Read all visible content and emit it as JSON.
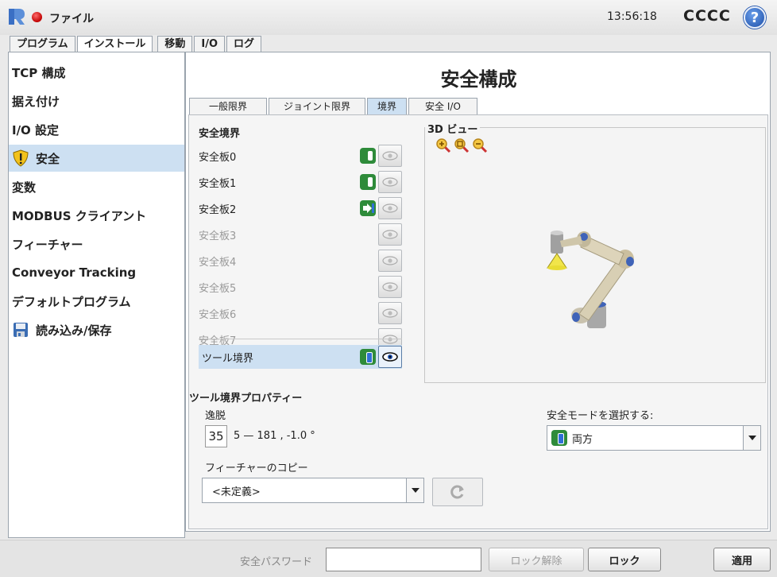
{
  "topbar": {
    "logo_icon": "ur-logo-icon",
    "status_color": "#d40000",
    "file_menu": "ファイル",
    "clock": "13:56:18",
    "robot_name": "CCCC",
    "help_label": "?"
  },
  "main_tabs": [
    {
      "label": "プログラム",
      "active": false
    },
    {
      "label": "インストール",
      "active": true
    },
    {
      "label": "移動",
      "active": false
    },
    {
      "label": "I/O",
      "active": false
    },
    {
      "label": "ログ",
      "active": false
    }
  ],
  "sidebar": {
    "items": [
      {
        "label": "TCP 構成"
      },
      {
        "label": "据え付け"
      },
      {
        "label": "I/O 設定"
      },
      {
        "label": "安全",
        "icon": "shield-warning-icon",
        "active": true
      },
      {
        "label": "変数"
      },
      {
        "label": "MODBUS クライアント"
      },
      {
        "label": "フィーチャー"
      },
      {
        "label": "Conveyor Tracking"
      },
      {
        "label": "デフォルトプログラム"
      },
      {
        "label": "読み込み/保存",
        "icon": "save-disk-icon"
      }
    ]
  },
  "content": {
    "title": "安全構成",
    "sub_tabs": [
      {
        "label": "一般限界",
        "active": false
      },
      {
        "label": "ジョイント限界",
        "active": false
      },
      {
        "label": "境界",
        "active": true
      },
      {
        "label": "安全 I/O",
        "active": false
      }
    ],
    "boundaries_label": "安全境界",
    "planes": [
      {
        "label": "安全板0",
        "mode_icon": "normal-mode-icon",
        "enabled": true
      },
      {
        "label": "安全板1",
        "mode_icon": "normal-mode-icon",
        "enabled": true
      },
      {
        "label": "安全板2",
        "mode_icon": "trigger-mode-icon",
        "enabled": true
      },
      {
        "label": "安全板3",
        "enabled": false
      },
      {
        "label": "安全板4",
        "enabled": false
      },
      {
        "label": "安全板5",
        "enabled": false
      },
      {
        "label": "安全板6",
        "enabled": false
      },
      {
        "label": "安全板7",
        "enabled": false
      }
    ],
    "tool_boundary": {
      "label": "ツール境界",
      "mode_icon": "both-mode-icon",
      "visible": true
    },
    "view3d": {
      "label": "3D ビュー",
      "zoom_icons": [
        "zoom-in-icon",
        "zoom-fit-icon",
        "zoom-out-icon"
      ]
    },
    "tool_props": {
      "label": "ツール境界プロパティー",
      "deviation_label": "逸脱",
      "deviation_value": "35",
      "range_text": "5 — 181 , -1.0 °",
      "feature_copy_label": "フィーチャーのコピー",
      "feature_copy_value": "<未定義>",
      "safety_mode_label": "安全モードを選択する:",
      "safety_mode_value": "両方"
    }
  },
  "bottombar": {
    "password_label": "安全パスワード",
    "unlock_label": "ロック解除",
    "lock_label": "ロック",
    "apply_label": "適用"
  }
}
